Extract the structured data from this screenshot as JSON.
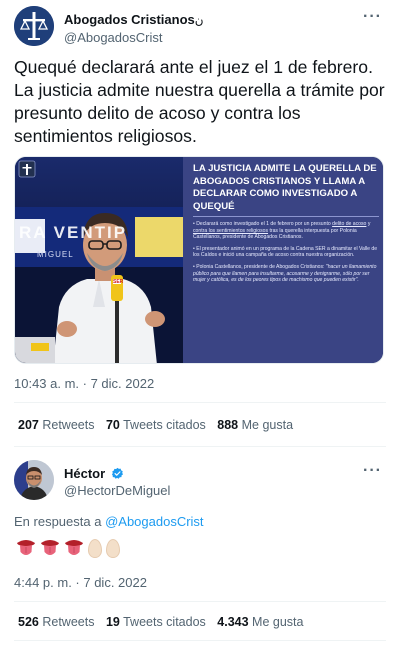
{
  "tweet1": {
    "author_name": "Abogados Cristianos",
    "author_name_suffix": "ن",
    "author_handle": "@AbogadosCrist",
    "text": "Quequé declarará ante el juez el 1 de febrero. La justicia admite nuestra querella a trámite por presunto delito de acoso y contra los sentimientos religiosos.",
    "media": {
      "headline": "La justicia admite la querella de Abogados Cristianos y llama a declarar como investigado a Quequé",
      "bullet1_a": "Declarará como investigado el 1 de febrero por un presunto",
      "bullet1_link1": "delito de acoso",
      "bullet1_mid": "y",
      "bullet1_link2": "contra los sentimientos religiosos",
      "bullet1_b": "tras la querella interpuesta por Polonia Castellanos, presidente de Abogados Cristianos.",
      "bullet2": "El presentador animó en un programa de la Cadena SER a dinamitar el Valle de los Caídos e inició una campaña de acoso contra nuestra organización.",
      "bullet3_a": "Polonia Castellanos, presidente de Abogados Cristianos:",
      "bullet3_quote": "\"hacer un llamamiento público para que llamen para insultarme, acosarme y denigrarme, sólo por ser mujer y católica, es de los peores tipos de machismo que pueden existir\".",
      "set_text": "RA VENTIP",
      "set_name": "MIGUEL",
      "mic_label": "SER"
    },
    "timestamp": "10:43 a. m. · 7 dic. 2022",
    "retweets_count": "207",
    "retweets_label": "Retweets",
    "quotes_count": "70",
    "quotes_label": "Tweets citados",
    "likes_count": "888",
    "likes_label": "Me gusta"
  },
  "tweet2": {
    "author_name": "Héctor",
    "author_handle": "@HectorDeMiguel",
    "reply_prefix": "En respuesta a",
    "reply_handle": "@AbogadosCrist",
    "emojis": [
      "tongue",
      "tongue",
      "tongue",
      "egg",
      "egg"
    ],
    "timestamp": "4:44 p. m. · 7 dic. 2022",
    "retweets_count": "526",
    "retweets_label": "Retweets",
    "quotes_count": "19",
    "quotes_label": "Tweets citados",
    "likes_count": "4.343",
    "likes_label": "Me gusta"
  },
  "colors": {
    "link": "#1d9bf0",
    "secondary_text": "#536471",
    "verified": "#1d9bf0",
    "media_panel": "#3a4484"
  },
  "icons": {
    "more": "more-horizontal-icon",
    "verified": "verified-badge-icon"
  }
}
